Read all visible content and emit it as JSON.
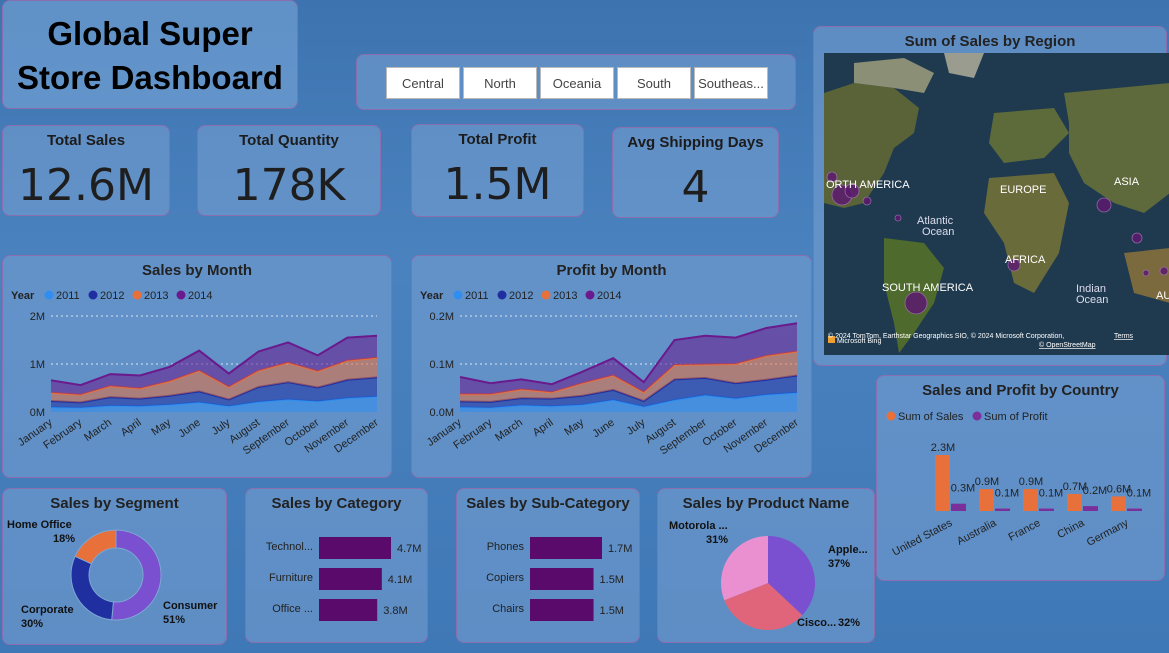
{
  "header": {
    "title_line1": "Global Super",
    "title_line2": "Store Dashboard"
  },
  "slicer": {
    "items": [
      "Central",
      "North",
      "Oceania",
      "South",
      "Southeas..."
    ]
  },
  "kpis": {
    "total_sales": {
      "label": "Total Sales",
      "value": "12.6M"
    },
    "total_quantity": {
      "label": "Total Quantity",
      "value": "178K"
    },
    "total_profit": {
      "label": "Total Profit",
      "value": "1.5M"
    },
    "avg_shipping": {
      "label": "Avg Shipping Days",
      "value": "4"
    }
  },
  "map": {
    "title": "Sum of Sales by Region",
    "labels": {
      "north_america": "ORTH AMERICA",
      "europe": "EUROPE",
      "asia": "ASIA",
      "atlantic": "Atlantic",
      "atlantic2": "Ocean",
      "africa": "AFRICA",
      "south_america": "SOUTH AMERICA",
      "indian": "Indian",
      "indian2": "Ocean",
      "au": "AU"
    },
    "attribution": "© 2024 TomTom, Earthstar Geographics SIO, © 2024 Microsoft Corporation,",
    "terms": "Terms",
    "osm": "© OpenStreetMap",
    "bing": "Microsoft Bing",
    "colors": {
      "bubble": "#5b1a6e",
      "land": "#4d5b33",
      "sea": "#1f3a4f"
    }
  },
  "colors": {
    "y2011": "#2f8ef0",
    "y2012": "#1f2fa0",
    "y2013": "#e8703a",
    "y2014": "#6a1a8c",
    "bar": "#5a0a6a",
    "sales": "#e8703a",
    "profit": "#7a2f9a"
  },
  "sales_by_month": {
    "chart_data": {
      "type": "area",
      "title": "Sales by Month",
      "legend_title": "Year",
      "categories": [
        "January",
        "February",
        "March",
        "April",
        "May",
        "June",
        "July",
        "August",
        "September",
        "October",
        "November",
        "December"
      ],
      "y_ticks": [
        "0M",
        "1M",
        "2M"
      ],
      "ylim": [
        0,
        2000000
      ],
      "series": [
        {
          "name": "2011",
          "values": [
            100000,
            90000,
            130000,
            120000,
            150000,
            200000,
            120000,
            210000,
            260000,
            220000,
            290000,
            320000
          ]
        },
        {
          "name": "2012",
          "values": [
            130000,
            110000,
            180000,
            160000,
            190000,
            230000,
            140000,
            310000,
            360000,
            290000,
            380000,
            400000
          ]
        },
        {
          "name": "2013",
          "values": [
            170000,
            160000,
            230000,
            210000,
            300000,
            430000,
            260000,
            340000,
            410000,
            340000,
            400000,
            410000
          ]
        },
        {
          "name": "2014",
          "values": [
            260000,
            200000,
            250000,
            270000,
            300000,
            420000,
            280000,
            400000,
            420000,
            330000,
            480000,
            460000
          ]
        }
      ],
      "legend_placement": "top-left"
    }
  },
  "profit_by_month": {
    "chart_data": {
      "type": "area",
      "title": "Profit by Month",
      "legend_title": "Year",
      "categories": [
        "January",
        "February",
        "March",
        "April",
        "May",
        "June",
        "July",
        "August",
        "September",
        "October",
        "November",
        "December"
      ],
      "y_ticks": [
        "0.0M",
        "0.1M",
        "0.2M"
      ],
      "ylim": [
        0,
        200000
      ],
      "series": [
        {
          "name": "2011",
          "values": [
            10000,
            9000,
            14000,
            12000,
            15000,
            25000,
            11000,
            25000,
            35000,
            28000,
            36000,
            40000
          ]
        },
        {
          "name": "2012",
          "values": [
            12000,
            12000,
            15000,
            16000,
            19000,
            21000,
            12000,
            43000,
            36000,
            32000,
            31000,
            36000
          ]
        },
        {
          "name": "2013",
          "values": [
            15000,
            16000,
            18000,
            13000,
            26000,
            30000,
            18000,
            30000,
            28000,
            40000,
            50000,
            50000
          ]
        },
        {
          "name": "2014",
          "values": [
            36000,
            23000,
            21000,
            17000,
            24000,
            36000,
            21000,
            52000,
            60000,
            55000,
            58000,
            59000
          ]
        }
      ],
      "legend_placement": "top-left"
    }
  },
  "sales_profit_country": {
    "chart_data": {
      "type": "bar",
      "title": "Sales and Profit by Country",
      "categories": [
        "United States",
        "Australia",
        "France",
        "China",
        "Germany"
      ],
      "series": [
        {
          "name": "Sum of Sales",
          "values": [
            2.3,
            0.9,
            0.9,
            0.7,
            0.6
          ],
          "labels": [
            "2.3M",
            "0.9M",
            "0.9M",
            "0.7M",
            "0.6M"
          ]
        },
        {
          "name": "Sum of Profit",
          "values": [
            0.3,
            0.1,
            0.1,
            0.2,
            0.1
          ],
          "labels": [
            "0.3M",
            "0.1M",
            "0.1M",
            "0.2M",
            "0.1M"
          ]
        }
      ],
      "legend_placement": "top-left"
    }
  },
  "segment": {
    "chart_data": {
      "type": "pie",
      "title": "Sales by Segment",
      "slices": [
        {
          "label": "Consumer",
          "pct_label": "51%",
          "value": 51,
          "color": "#7a4fd0"
        },
        {
          "label": "Corporate",
          "pct_label": "30%",
          "value": 30,
          "color": "#1f2fa0"
        },
        {
          "label": "Home Office",
          "pct_label": "18%",
          "value": 18,
          "color": "#e8703a"
        }
      ]
    }
  },
  "category": {
    "chart_data": {
      "type": "bar",
      "title": "Sales by Category",
      "categories": [
        "Technol...",
        "Furniture",
        "Office ..."
      ],
      "values": [
        4.7,
        4.1,
        3.8
      ],
      "labels": [
        "4.7M",
        "4.1M",
        "3.8M"
      ]
    }
  },
  "subcategory": {
    "chart_data": {
      "type": "bar",
      "title": "Sales by Sub-Category",
      "categories": [
        "Phones",
        "Copiers",
        "Chairs"
      ],
      "values": [
        1.7,
        1.5,
        1.5
      ],
      "labels": [
        "1.7M",
        "1.5M",
        "1.5M"
      ]
    }
  },
  "product": {
    "chart_data": {
      "type": "pie",
      "title": "Sales by Product Name",
      "slices": [
        {
          "label": "Apple...",
          "pct_label": "37%",
          "value": 37,
          "color": "#7a4fd0"
        },
        {
          "label": "Cisco...",
          "pct_label": "32%",
          "value": 32,
          "color": "#e0647a"
        },
        {
          "label": "Motorola ...",
          "pct_label": "31%",
          "value": 31,
          "color": "#ea8fcf"
        }
      ]
    }
  }
}
